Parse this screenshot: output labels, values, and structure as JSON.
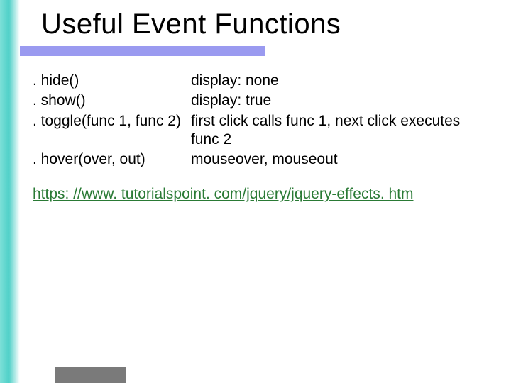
{
  "title": "Useful Event Functions",
  "functions": [
    {
      "name": ". hide()",
      "desc": "display: none"
    },
    {
      "name": ". show()",
      "desc": "display: true"
    },
    {
      "name": ". toggle(func 1, func 2)",
      "desc": "first click calls func 1, next click executes func 2"
    },
    {
      "name": ". hover(over, out)",
      "desc": "mouseover, mouseout"
    }
  ],
  "link": "https: //www. tutorialspoint. com/jquery/jquery-effects. htm"
}
